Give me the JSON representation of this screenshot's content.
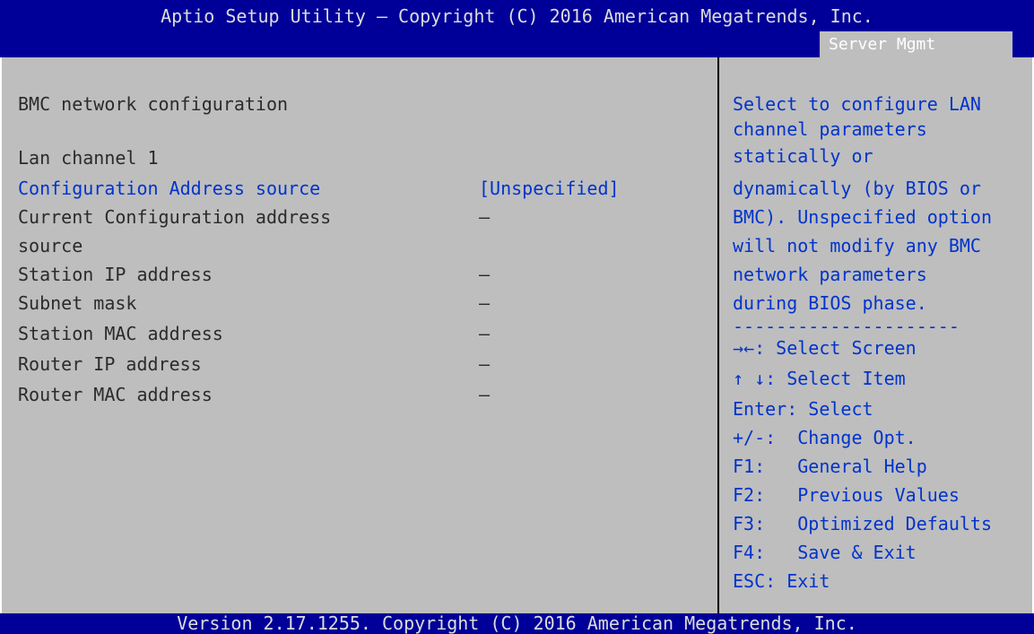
{
  "header": {
    "title": "Aptio Setup Utility – Copyright (C) 2016 American Megatrends, Inc.",
    "active_tab": "Server Mgmt"
  },
  "main": {
    "section_title": "BMC network configuration",
    "channel_label": "Lan channel 1",
    "config_source": {
      "label": "Configuration Address source",
      "value": "[Unspecified]"
    },
    "current_source": {
      "label_line1": "Current Configuration address",
      "label_line2": "source",
      "value": "–"
    },
    "station_ip": {
      "label": "Station IP address",
      "value": "–"
    },
    "subnet_mask": {
      "label": "Subnet mask",
      "value": "–"
    },
    "station_mac": {
      "label": "Station MAC address",
      "value": "–"
    },
    "router_ip": {
      "label": "Router IP address",
      "value": "–"
    },
    "router_mac": {
      "label": "Router MAC address",
      "value": "–"
    }
  },
  "help": {
    "description_lines": [
      "Select to configure LAN",
      "channel parameters",
      "statically or",
      "dynamically (by BIOS or",
      "BMC). Unspecified option",
      "will not modify any BMC",
      "network parameters",
      "during BIOS phase."
    ],
    "separator": "---------------------",
    "keys": [
      "→←: Select Screen",
      "↑ ↓: Select Item",
      "Enter: Select",
      "+/-:  Change Opt.",
      "F1:   General Help",
      "F2:   Previous Values",
      "F3:   Optimized Defaults",
      "F4:   Save & Exit",
      "ESC: Exit"
    ]
  },
  "footer": {
    "text": "Version 2.17.1255. Copyright (C) 2016 American Megatrends, Inc."
  },
  "colors": {
    "title_bar": "#000099",
    "panel": "#bebebe",
    "highlight_text": "#0033cc"
  }
}
